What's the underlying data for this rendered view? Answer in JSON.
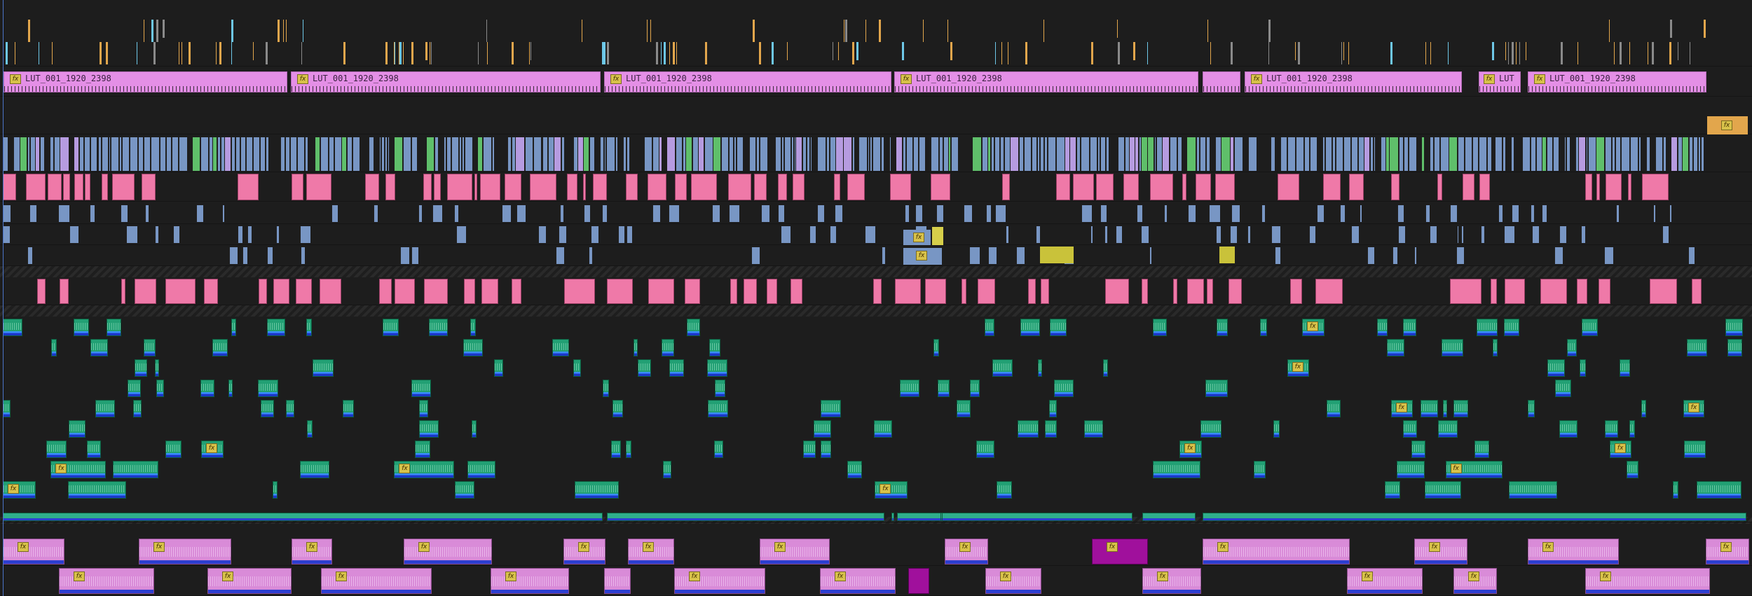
{
  "timeline": {
    "adjustment_label": "LUT_001_1920_2398",
    "fx_label": "fx",
    "adjustment_clips": [
      {
        "label": "LUT_001_1920_2398"
      },
      {
        "label": "LUT_001_1920_2398"
      },
      {
        "label": "LUT_001_1920_2398"
      },
      {
        "label": "LUT_001_1920_2398"
      },
      {
        "label": "LUT_001_1920_2398"
      },
      {
        "label": "LUT_001_1920_2398"
      },
      {
        "label": "LUT"
      },
      {
        "label": "LUT_001_1920_2398"
      }
    ],
    "colors": {
      "background": "#1d1d1d",
      "adjustment": "#e48fe6",
      "video": "#7896c4",
      "video_pink": "#ef79a8",
      "audio": "#22a074",
      "music": "#d98bd8",
      "marker_orange": "#e2a64c",
      "fx_badge": "#d8c24a",
      "playhead": "#4b74c8"
    },
    "icons": [
      "fx-badge-icon"
    ]
  }
}
